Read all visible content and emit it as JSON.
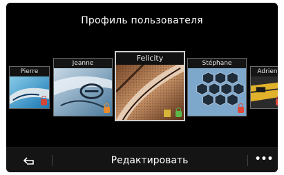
{
  "header": {
    "title": "Профиль пользователя"
  },
  "profiles": [
    {
      "name": "Pierre",
      "lock": "red"
    },
    {
      "name": "Jeanne",
      "lock": "orange"
    },
    {
      "name": "Felicity",
      "lock": "green",
      "selected": true
    },
    {
      "name": "Stéphane",
      "lock": "red"
    },
    {
      "name": "Adrien",
      "lock": "red"
    }
  ],
  "bottom": {
    "back_icon": "back-arrow-icon",
    "edit_label": "Редактировать",
    "more_label": "•••"
  }
}
